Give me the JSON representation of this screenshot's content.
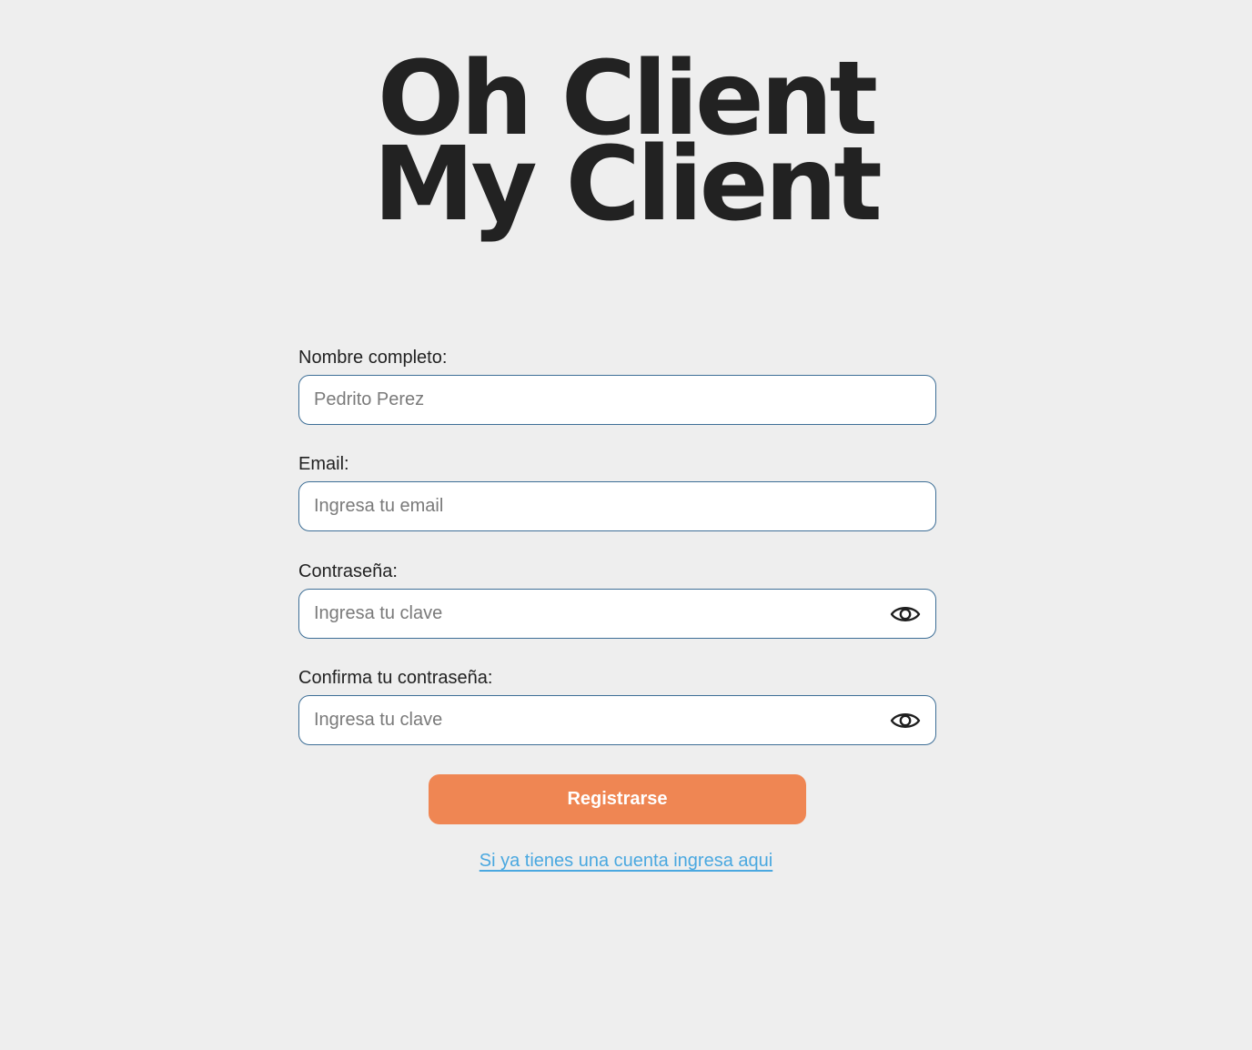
{
  "logo": {
    "line1": "Oh Client",
    "line2": "My Client"
  },
  "form": {
    "name": {
      "label": "Nombre completo:",
      "placeholder": "Pedrito Perez"
    },
    "email": {
      "label": "Email:",
      "placeholder": "Ingresa tu email"
    },
    "password": {
      "label": "Contraseña:",
      "placeholder": "Ingresa tu clave",
      "icon": "eye-icon"
    },
    "confirm_password": {
      "label": "Confirma tu contraseña:",
      "placeholder": "Ingresa tu clave",
      "icon": "eye-icon"
    },
    "submit_label": "Registrarse",
    "login_link": "Si ya tienes una cuenta ingresa aqui"
  },
  "colors": {
    "background": "#eeeeee",
    "text": "#222222",
    "input_border": "#3d6e96",
    "button": "#ef8653",
    "link": "#4aa8e0"
  }
}
